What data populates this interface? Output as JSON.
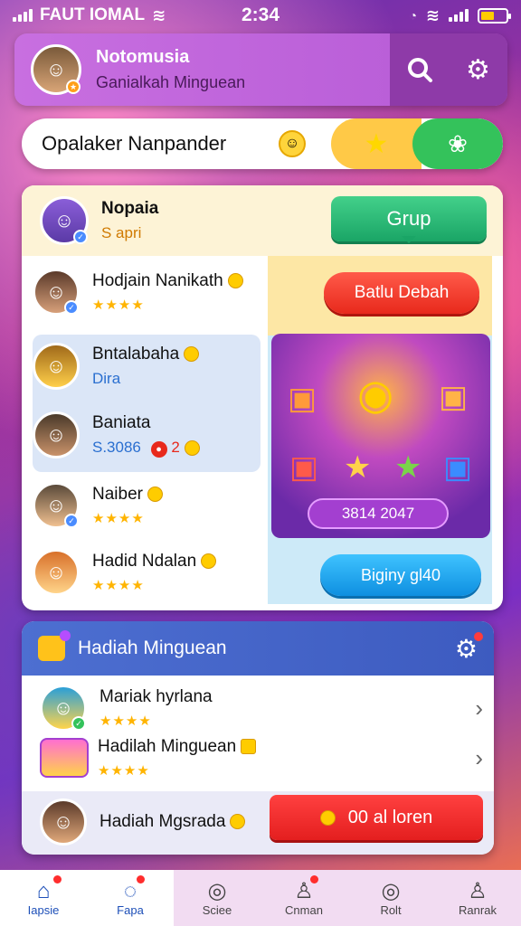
{
  "status_bar": {
    "carrier": "FAUT IOMAL",
    "time": "2:34"
  },
  "profile": {
    "name": "Notomusia",
    "subtitle": "Ganialkah Minguean",
    "avatar_icon": "boy-avatar-icon",
    "search_icon": "search-icon",
    "settings_icon": "gear-icon"
  },
  "search_bar": {
    "text": "Opalaker Nanpander",
    "emoji_icon": "smiley-icon",
    "star_icon": "star-icon",
    "chat_icon": "chat-icon"
  },
  "group_panel": {
    "header_name": "Nopaia",
    "header_sub": "S apri",
    "group_button": "Grup",
    "friends": [
      {
        "name": "Hodjain Nanikath",
        "sub": "",
        "stars": "★★★★"
      },
      {
        "name": "Bntalabaha",
        "sub": "Dira",
        "stars": ""
      },
      {
        "name": "Baniata",
        "sub": "S.3086",
        "badge": "2",
        "stars": ""
      },
      {
        "name": "Naiber",
        "sub": "",
        "stars": "★★★★"
      },
      {
        "name": "Hadid Ndalan",
        "sub": "",
        "stars": "★★★★"
      }
    ],
    "red_button": "Batlu Debah",
    "reward_value": "3814 2047",
    "blue_button": "Biginy gl40"
  },
  "weekly": {
    "title": "Hadiah Minguean",
    "items": [
      {
        "name": "Mariak hyrlana",
        "stars": "★★★★"
      },
      {
        "name": "Hadilah Minguean",
        "stars": "★★★★"
      },
      {
        "name": "Hadiah Mgsrada",
        "stars": ""
      }
    ],
    "action_button": "00 al loren"
  },
  "tabs": [
    {
      "label": "Iapsie",
      "icon": "home-icon",
      "active": true
    },
    {
      "label": "Fapa",
      "icon": "chat-icon",
      "active": false
    },
    {
      "label": "Sciee",
      "icon": "search-icon",
      "active": false
    },
    {
      "label": "Cnman",
      "icon": "user-icon",
      "active": false
    },
    {
      "label": "Rolt",
      "icon": "search-icon",
      "active": false
    },
    {
      "label": "Ranrak",
      "icon": "user-icon",
      "active": false
    }
  ],
  "colors": {
    "accent_purple": "#b65ad6",
    "green": "#1aa566",
    "red": "#e8291c",
    "blue": "#0e8fe0",
    "header_blue": "#3d5bc0"
  }
}
